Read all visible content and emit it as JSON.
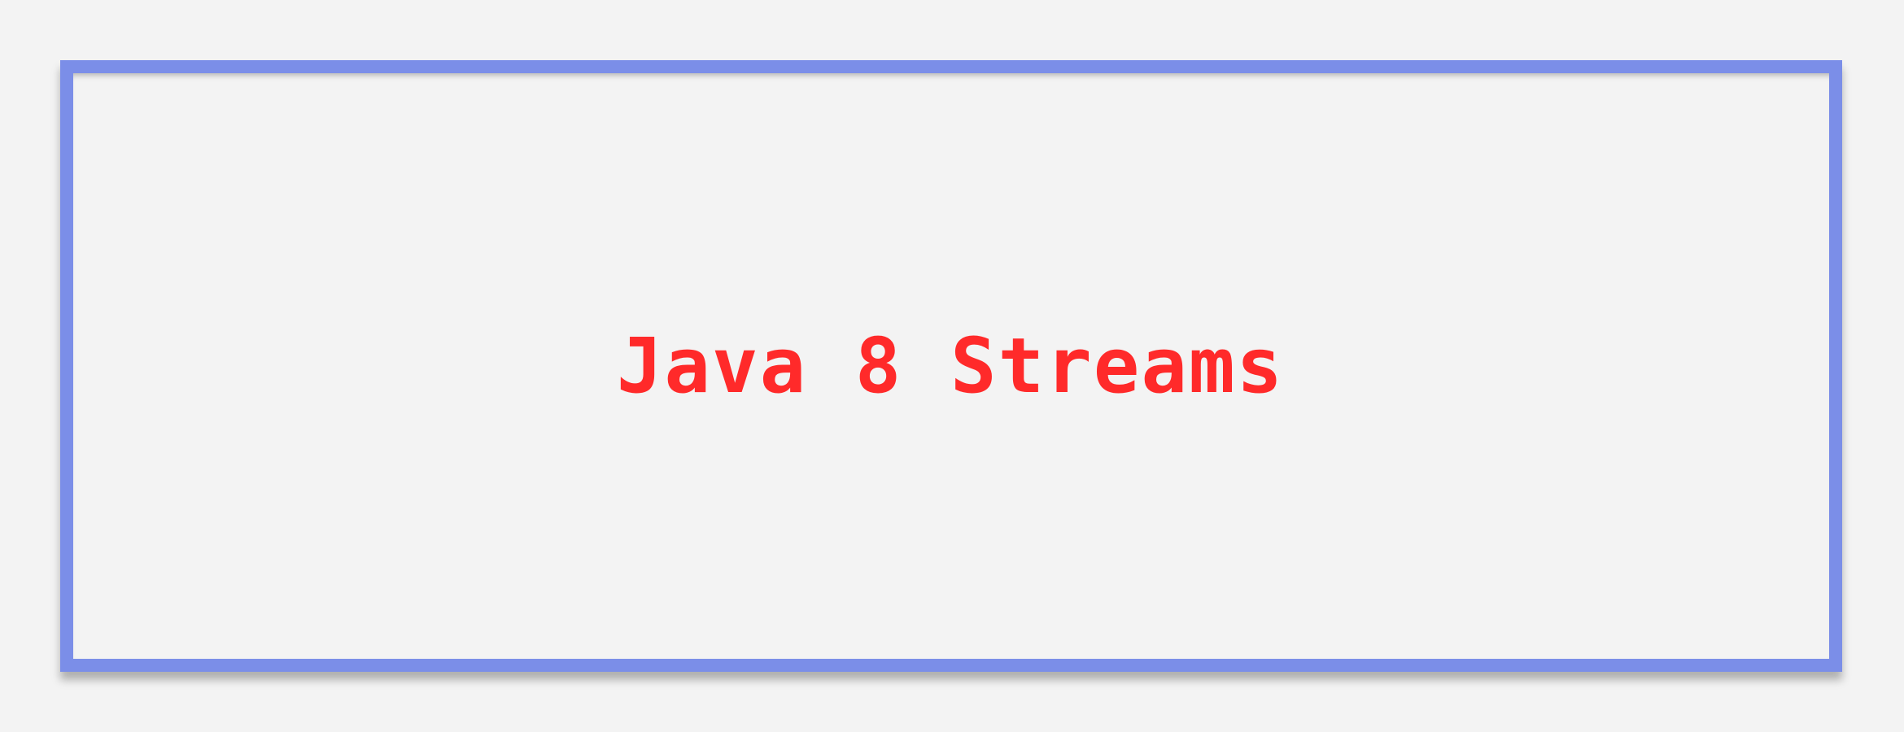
{
  "frame": {
    "border_color": "#7b8ee8",
    "background_color": "#f3f3f3"
  },
  "title": {
    "text": "Java 8 Streams",
    "color": "#ff2a2a"
  }
}
